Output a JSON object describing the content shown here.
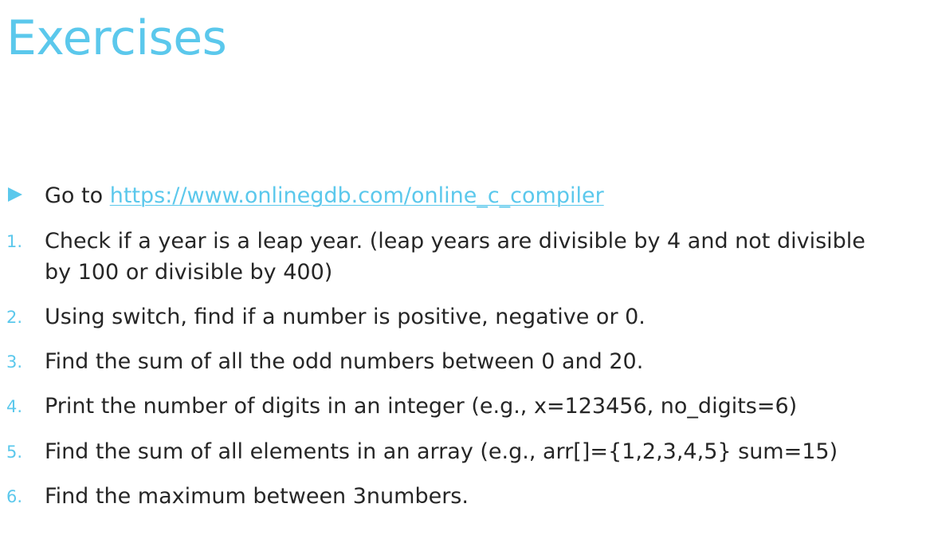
{
  "title": "Exercises",
  "intro": {
    "prefix": "Go to ",
    "link": "https://www.onlinegdb.com/online_c_compiler"
  },
  "items": [
    {
      "number": "1.",
      "lines": [
        "Check if a year is a leap year. (leap years are divisible by 4 and not divisible",
        "by 100 or divisible by 400)"
      ]
    },
    {
      "number": "2.",
      "lines": [
        "Using switch, find if a number is positive, negative or 0."
      ]
    },
    {
      "number": "3.",
      "lines": [
        "Find the sum of all the odd numbers between 0 and 20."
      ]
    },
    {
      "number": "4.",
      "lines": [
        "Print the number of digits in an integer (e.g., x=123456, no_digits=6)"
      ]
    },
    {
      "number": "5.",
      "lines": [
        "Find the sum of all elements in an array (e.g., arr[]={1,2,3,4,5} sum=15)"
      ]
    },
    {
      "number": "6.",
      "lines": [
        "Find the maximum between 3numbers."
      ]
    }
  ],
  "colors": {
    "accent": "#5BC8EC",
    "text": "#262626",
    "background": "#FFFFFF"
  },
  "icons": {
    "bullet": "triangle-right-icon"
  }
}
